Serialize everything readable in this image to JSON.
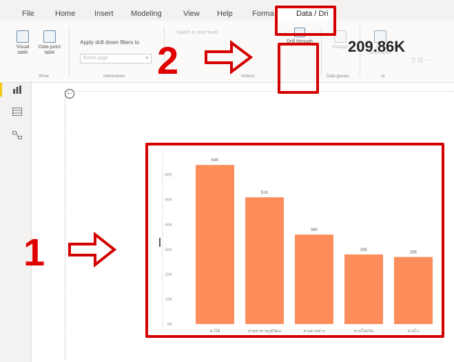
{
  "ribbon": {
    "tabs": [
      {
        "label": "File"
      },
      {
        "label": "Home"
      },
      {
        "label": "Insert"
      },
      {
        "label": "Modeling"
      },
      {
        "label": "View"
      },
      {
        "label": "Help"
      },
      {
        "label": "Forma"
      },
      {
        "label": "Data / Dri"
      }
    ],
    "buttons": {
      "visual_table": "Visual table",
      "data_point_table": "Data point table",
      "apply_drill_down": "Apply drill down filters to",
      "entire_page_placeholder": "Entire page",
      "switch_to_next_level": "Switch to next level",
      "drill_through": "Drill through",
      "groups": "Groups",
      "find_anomalies": "Find anomalies"
    },
    "groups": {
      "show": "Show",
      "interactions": "Interactions",
      "actions": "Actions",
      "data_groups": "Data groups",
      "ai": "AI"
    }
  },
  "canvas": {
    "kpi_value": "209.86K",
    "back_icon": "back-arrow-icon"
  },
  "annotations": {
    "step1": "1",
    "step2": "2",
    "color": "#d40000"
  },
  "chart_data": {
    "type": "bar",
    "categories": [
      "คาโต้",
      "สายตาพาหุภูมิวัตน",
      "สายตาลล่าง",
      "สายใหม่วัน",
      "สายไว"
    ],
    "values": [
      64,
      51,
      36,
      28,
      27
    ],
    "data_labels": [
      "64K",
      "51K",
      "36K",
      "28K",
      "28K"
    ],
    "y_ticks": [
      "0K",
      "10K",
      "20K",
      "30K",
      "40K",
      "50K",
      "60K"
    ],
    "ylim": [
      0,
      66
    ],
    "bar_color": "#fd8e5b",
    "grid": false
  }
}
